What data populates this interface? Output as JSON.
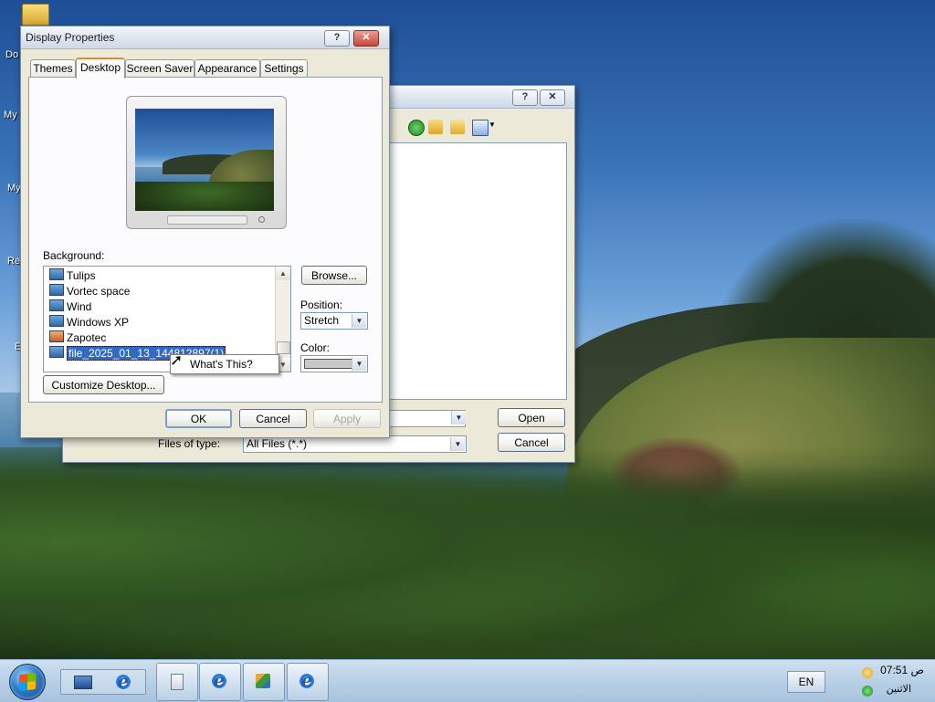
{
  "desktop": {
    "icon_labels": [
      "Do",
      "My",
      "My",
      "Re",
      "E"
    ]
  },
  "browse_dialog": {
    "title_help": "?",
    "title_close": "✕",
    "filename_value": "",
    "files_of_type_label": "Files of type:",
    "files_of_type_value": "All Files (*.*)",
    "open_label": "Open",
    "cancel_label": "Cancel"
  },
  "display_properties": {
    "title": "Display Properties",
    "help_label": "?",
    "close_label": "✕",
    "tabs": [
      {
        "label": "Themes"
      },
      {
        "label": "Desktop"
      },
      {
        "label": "Screen Saver"
      },
      {
        "label": "Appearance"
      },
      {
        "label": "Settings"
      }
    ],
    "background_label": "Background:",
    "background_items": [
      {
        "label": "Tulips"
      },
      {
        "label": "Vortec space"
      },
      {
        "label": "Wind"
      },
      {
        "label": "Windows XP"
      },
      {
        "label": "Zapotec"
      },
      {
        "label": "file_2025_01_13_144812897(1)"
      }
    ],
    "browse_label": "Browse...",
    "position_label": "Position:",
    "position_value": "Stretch",
    "color_label": "Color:",
    "customize_label": "Customize Desktop...",
    "context_menu_item": "What's This?",
    "ok_label": "OK",
    "cancel_label": "Cancel",
    "apply_label": "Apply",
    "color_swatch": "#c8c8c8"
  },
  "taskbar": {
    "language": "EN",
    "clock_time": "07:51 ص",
    "clock_day": "الاثنين"
  }
}
